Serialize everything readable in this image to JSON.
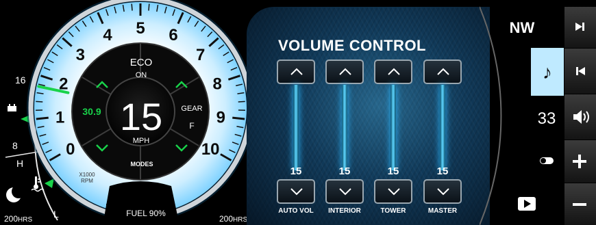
{
  "speedometer": {
    "ticks": [
      "0",
      "1",
      "2",
      "3",
      "4",
      "5",
      "6",
      "7",
      "8",
      "9",
      "10"
    ],
    "multiplier": "X1000",
    "unit_rpm": "RPM",
    "rpm_fraction": 0.175,
    "speed": "15",
    "speed_unit": "MPH",
    "eco_label": "ECO",
    "eco_state": "ON",
    "gear_label": "GEAR",
    "gear_value": "F",
    "modes_label": "MODES",
    "side_value": "30.9",
    "fuel_label": "FUEL 90%",
    "hours_left": "200",
    "hours_right": "200",
    "hours_unit": "HRS",
    "accent_color": "#19d24a"
  },
  "left_gauges": {
    "battery_high": "16",
    "battery_low": "8",
    "temp_high": "H",
    "temp_low": "L",
    "battery_icon": "battery-icon",
    "temp_icon": "coolant-temp-icon",
    "moon_icon": "moon-icon"
  },
  "volume": {
    "title": "VOLUME CONTROL",
    "channels": [
      {
        "label": "AUTO VOL",
        "value": "15"
      },
      {
        "label": "INTERIOR",
        "value": "15"
      },
      {
        "label": "TOWER",
        "value": "15"
      },
      {
        "label": "MASTER",
        "value": "15"
      }
    ]
  },
  "sidebar": {
    "heading": "NW",
    "number": "33",
    "active_color": "#bfeaff",
    "icons": [
      "music-note-icon",
      "toggle-icon",
      "play-icon",
      "next-track-icon",
      "prev-track-icon",
      "speaker-icon",
      "plus-icon",
      "minus-icon"
    ]
  }
}
